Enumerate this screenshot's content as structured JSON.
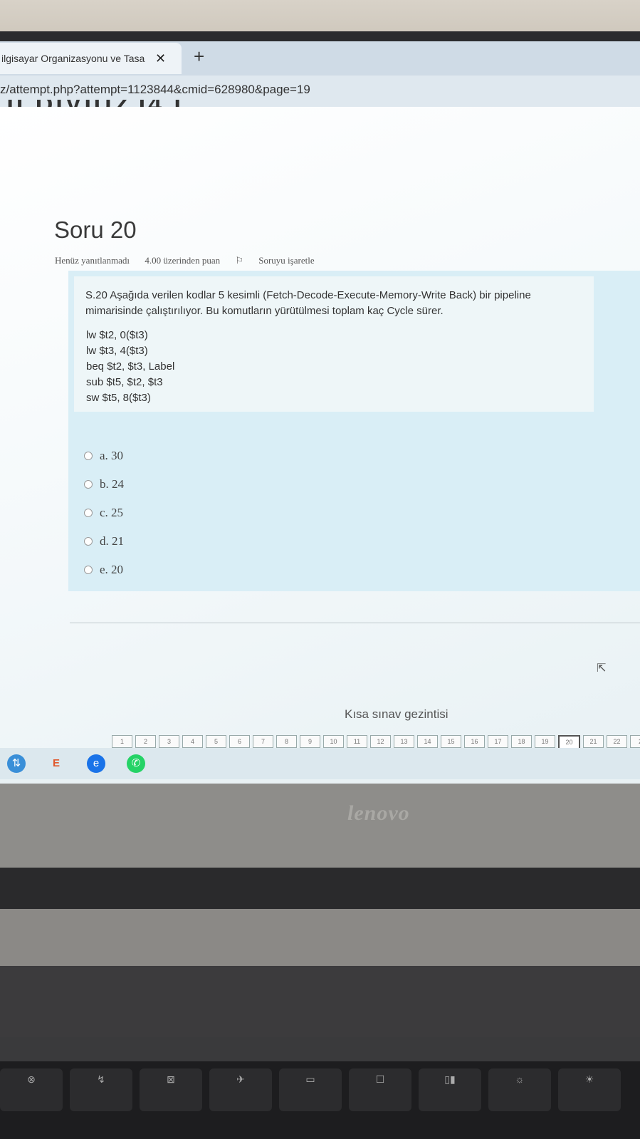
{
  "browser": {
    "tab_title": "ilgisayar Organizasyonu ve Tasa",
    "tab_close": "✕",
    "new_tab": "+",
    "url": "z/attempt.php?attempt=1123844&cmid=628980&page=19",
    "cut_heading": "JI DIVIUZJ4 I"
  },
  "question": {
    "title": "Soru 20",
    "status": "Henüz yanıtlanmadı",
    "points": "4.00 üzerinden puan",
    "flag_label": "Soruyu işaretle",
    "text": "S.20 Aşağıda verilen kodlar 5 kesimli (Fetch-Decode-Execute-Memory-Write Back) bir pipeline mimarisinde çalıştırılıyor. Bu komutların yürütülmesi toplam kaç Cycle sürer.",
    "code": [
      "lw $t2, 0($t3)",
      "lw $t3, 4($t3)",
      "beq $t2, $t3, Label",
      "sub $t5, $t2, $t3",
      "sw $t5, 8($t3)"
    ],
    "answers": [
      "a. 30",
      "b. 24",
      "c. 25",
      "d. 21",
      "e. 20"
    ]
  },
  "quiz_nav": {
    "title": "Kısa sınav gezintisi",
    "pages": [
      "1",
      "2",
      "3",
      "4",
      "5",
      "6",
      "7",
      "8",
      "9",
      "10",
      "11",
      "12",
      "13",
      "14",
      "15",
      "16",
      "17",
      "18",
      "19",
      "20",
      "21",
      "22",
      "2"
    ],
    "current": "20"
  },
  "laptop": {
    "brand": "lenovo"
  },
  "colors": {
    "accent": "#d9eef6",
    "edge_blue": "#1a73e8",
    "whatsapp": "#25d366"
  }
}
